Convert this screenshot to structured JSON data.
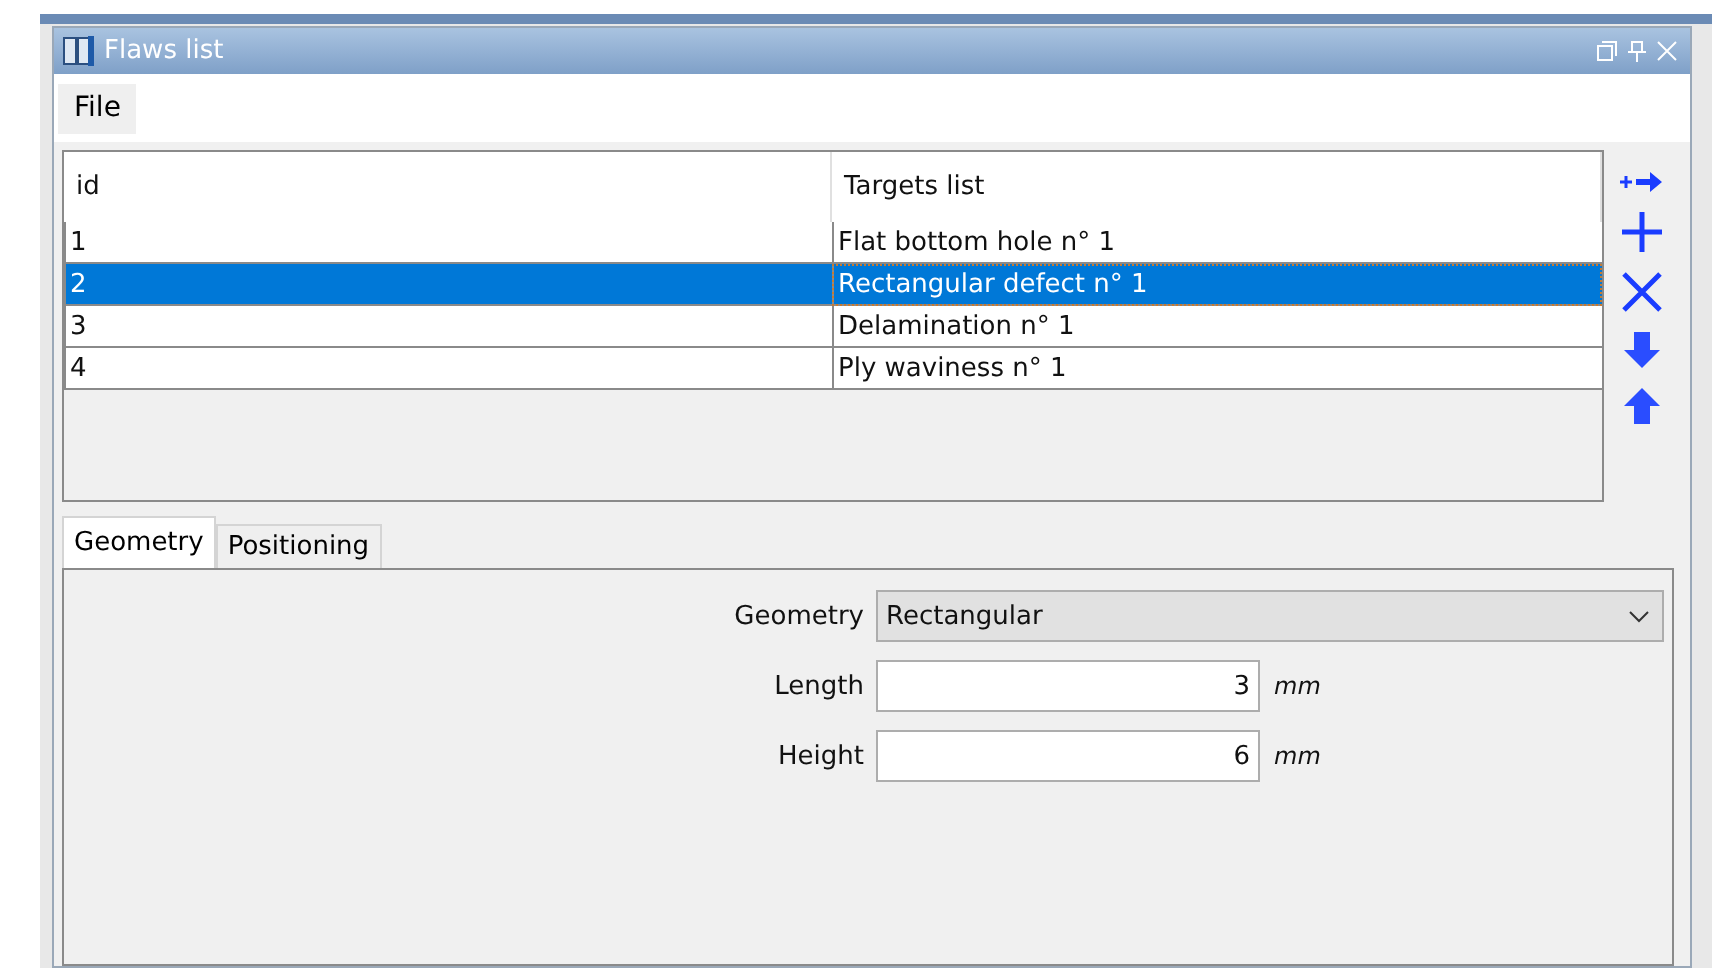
{
  "window": {
    "title": "Flaws list"
  },
  "menu": [
    "File"
  ],
  "table": {
    "columns": [
      "id",
      "Targets list"
    ],
    "rows": [
      {
        "cells": [
          "1",
          "Flat bottom hole n° 1"
        ],
        "selected": false
      },
      {
        "cells": [
          "2",
          "Rectangular defect n° 1"
        ],
        "selected": true
      },
      {
        "cells": [
          "3",
          "Delamination n° 1"
        ],
        "selected": false
      },
      {
        "cells": [
          "4",
          "Ply waviness n° 1"
        ],
        "selected": false
      }
    ]
  },
  "tabs": [
    {
      "label": "Geometry",
      "selected": true
    },
    {
      "label": "Positioning",
      "selected": false
    }
  ],
  "form": [
    {
      "kind": "select",
      "label": "Geometry",
      "value": "Rectangular"
    },
    {
      "kind": "number",
      "label": "Length",
      "value": "3",
      "unit": "mm"
    },
    {
      "kind": "number",
      "label": "Height",
      "value": "6",
      "unit": "mm"
    }
  ]
}
